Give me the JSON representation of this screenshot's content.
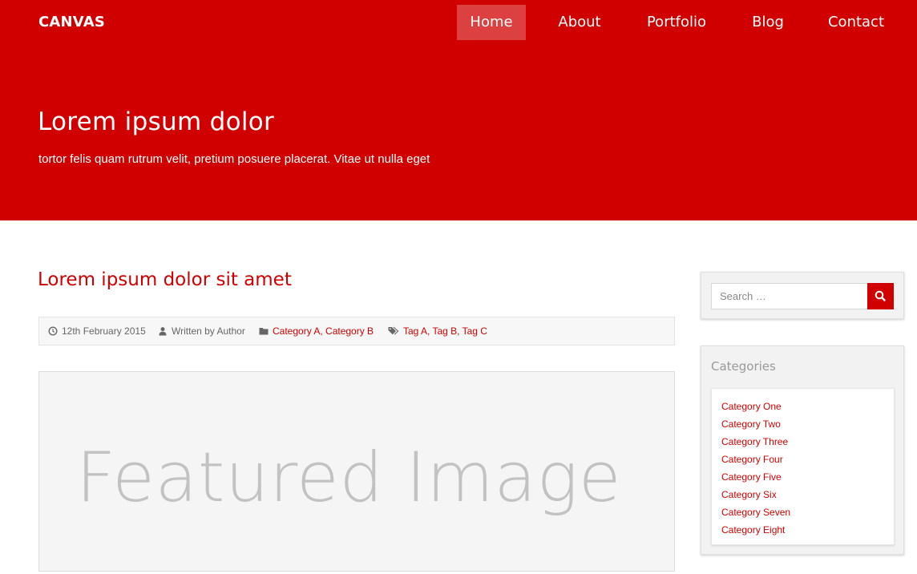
{
  "brand": {
    "name": "CANVAS"
  },
  "nav": {
    "items": [
      {
        "label": "Home"
      },
      {
        "label": "About"
      },
      {
        "label": "Portfolio"
      },
      {
        "label": "Blog"
      },
      {
        "label": "Contact"
      }
    ],
    "active": "Home"
  },
  "hero": {
    "title": "Lorem ipsum dolor",
    "subtitle": "tortor felis quam rutrum velit, pretium posuere placerat. Vitae ut nulla eget"
  },
  "post": {
    "title": "Lorem ipsum dolor sit amet",
    "meta": {
      "date": "12th February 2015",
      "author": "Written by Author",
      "categories": "Category A, Category B",
      "tags": "Tag A, Tag B, Tag C"
    },
    "featured_image_text": "Featured Image"
  },
  "sidebar": {
    "search": {
      "placeholder": "Search …"
    },
    "categories": {
      "title": "Categories",
      "items": [
        {
          "label": "Category One"
        },
        {
          "label": "Category Two"
        },
        {
          "label": "Category Three"
        },
        {
          "label": "Category Four"
        },
        {
          "label": "Category Five"
        },
        {
          "label": "Category Six"
        },
        {
          "label": "Category Seven"
        },
        {
          "label": "Category Eight"
        }
      ]
    }
  },
  "icons": {
    "date": "clock-icon",
    "author": "user-icon",
    "categories": "folder-icon",
    "tags": "tags-icon",
    "search": "search-icon"
  },
  "colors": {
    "accent": "#d10000",
    "hero_bg": "#d10000"
  }
}
